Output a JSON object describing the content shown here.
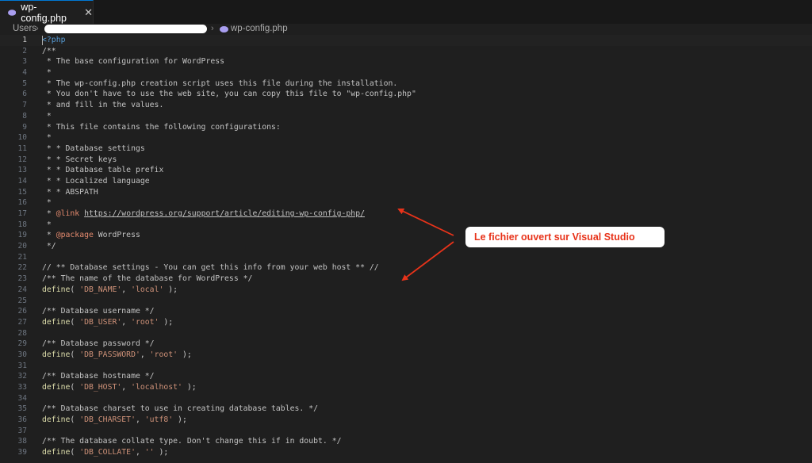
{
  "tab": {
    "label": "wp-config.php",
    "close": "✕"
  },
  "breadcrumb": {
    "root": "Users",
    "file": "wp-config.php"
  },
  "annotation": {
    "text": "Le fichier ouvert sur Visual Studio",
    "color": "#e8331a"
  },
  "colors": {
    "accent": "#0078d4",
    "php_icon": "#a99ef0",
    "background": "#1f1f1f"
  },
  "editor": {
    "active_line": 1,
    "lines": [
      {
        "n": "1",
        "t": [
          [
            "tagc",
            "<?php"
          ]
        ]
      },
      {
        "n": "2",
        "t": [
          [
            "com",
            "/**"
          ]
        ]
      },
      {
        "n": "3",
        "t": [
          [
            "com",
            " * The base configuration for WordPress"
          ]
        ]
      },
      {
        "n": "4",
        "t": [
          [
            "com",
            " *"
          ]
        ]
      },
      {
        "n": "5",
        "t": [
          [
            "com",
            " * The wp-config.php creation script uses this file during the installation."
          ]
        ]
      },
      {
        "n": "6",
        "t": [
          [
            "com",
            " * You don't have to use the web site, you can copy this file to \"wp-config.php\""
          ]
        ]
      },
      {
        "n": "7",
        "t": [
          [
            "com",
            " * and fill in the values."
          ]
        ]
      },
      {
        "n": "8",
        "t": [
          [
            "com",
            " *"
          ]
        ]
      },
      {
        "n": "9",
        "t": [
          [
            "com",
            " * This file contains the following configurations:"
          ]
        ]
      },
      {
        "n": "10",
        "t": [
          [
            "com",
            " *"
          ]
        ]
      },
      {
        "n": "11",
        "t": [
          [
            "com",
            " * * Database settings"
          ]
        ]
      },
      {
        "n": "12",
        "t": [
          [
            "com",
            " * * Secret keys"
          ]
        ]
      },
      {
        "n": "13",
        "t": [
          [
            "com",
            " * * Database table prefix"
          ]
        ]
      },
      {
        "n": "14",
        "t": [
          [
            "com",
            " * * Localized language"
          ]
        ]
      },
      {
        "n": "15",
        "t": [
          [
            "com",
            " * * ABSPATH"
          ]
        ]
      },
      {
        "n": "16",
        "t": [
          [
            "com",
            " *"
          ]
        ]
      },
      {
        "n": "17",
        "t": [
          [
            "com",
            " * "
          ],
          [
            "kw",
            "@link"
          ],
          [
            "com",
            " "
          ],
          [
            "lnk",
            "https://wordpress.org/support/article/editing-wp-config-php/"
          ]
        ]
      },
      {
        "n": "18",
        "t": [
          [
            "com",
            " *"
          ]
        ]
      },
      {
        "n": "19",
        "t": [
          [
            "com",
            " * "
          ],
          [
            "kw",
            "@package"
          ],
          [
            "com",
            " WordPress"
          ]
        ]
      },
      {
        "n": "20",
        "t": [
          [
            "com",
            " */"
          ]
        ]
      },
      {
        "n": "21",
        "t": []
      },
      {
        "n": "22",
        "t": [
          [
            "com",
            "// ** Database settings - You can get this info from your web host ** //"
          ]
        ]
      },
      {
        "n": "23",
        "t": [
          [
            "com",
            "/** The name of the database for WordPress */"
          ]
        ]
      },
      {
        "n": "24",
        "t": [
          [
            "fn",
            "define"
          ],
          [
            "punc",
            "( "
          ],
          [
            "str",
            "'DB_NAME'"
          ],
          [
            "punc",
            ", "
          ],
          [
            "str",
            "'local'"
          ],
          [
            "punc",
            " );"
          ]
        ]
      },
      {
        "n": "25",
        "t": []
      },
      {
        "n": "26",
        "t": [
          [
            "com",
            "/** Database username */"
          ]
        ]
      },
      {
        "n": "27",
        "t": [
          [
            "fn",
            "define"
          ],
          [
            "punc",
            "( "
          ],
          [
            "str",
            "'DB_USER'"
          ],
          [
            "punc",
            ", "
          ],
          [
            "str",
            "'root'"
          ],
          [
            "punc",
            " );"
          ]
        ]
      },
      {
        "n": "28",
        "t": []
      },
      {
        "n": "29",
        "t": [
          [
            "com",
            "/** Database password */"
          ]
        ]
      },
      {
        "n": "30",
        "t": [
          [
            "fn",
            "define"
          ],
          [
            "punc",
            "( "
          ],
          [
            "str",
            "'DB_PASSWORD'"
          ],
          [
            "punc",
            ", "
          ],
          [
            "str",
            "'root'"
          ],
          [
            "punc",
            " );"
          ]
        ]
      },
      {
        "n": "31",
        "t": []
      },
      {
        "n": "32",
        "t": [
          [
            "com",
            "/** Database hostname */"
          ]
        ]
      },
      {
        "n": "33",
        "t": [
          [
            "fn",
            "define"
          ],
          [
            "punc",
            "( "
          ],
          [
            "str",
            "'DB_HOST'"
          ],
          [
            "punc",
            ", "
          ],
          [
            "str",
            "'localhost'"
          ],
          [
            "punc",
            " );"
          ]
        ]
      },
      {
        "n": "34",
        "t": []
      },
      {
        "n": "35",
        "t": [
          [
            "com",
            "/** Database charset to use in creating database tables. */"
          ]
        ]
      },
      {
        "n": "36",
        "t": [
          [
            "fn",
            "define"
          ],
          [
            "punc",
            "( "
          ],
          [
            "str",
            "'DB_CHARSET'"
          ],
          [
            "punc",
            ", "
          ],
          [
            "str",
            "'utf8'"
          ],
          [
            "punc",
            " );"
          ]
        ]
      },
      {
        "n": "37",
        "t": []
      },
      {
        "n": "38",
        "t": [
          [
            "com",
            "/** The database collate type. Don't change this if in doubt. */"
          ]
        ]
      },
      {
        "n": "39",
        "t": [
          [
            "fn",
            "define"
          ],
          [
            "punc",
            "( "
          ],
          [
            "str",
            "'DB_COLLATE'"
          ],
          [
            "punc",
            ", "
          ],
          [
            "str",
            "''"
          ],
          [
            "punc",
            " );"
          ]
        ]
      }
    ]
  }
}
